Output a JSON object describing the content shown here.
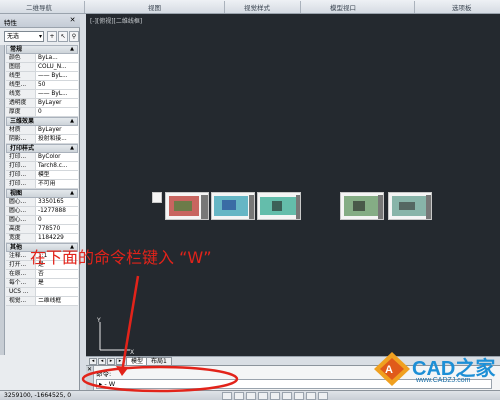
{
  "ribbon": {
    "panels": [
      "二维导航",
      "视图",
      "视觉样式",
      "模型视口",
      "选项板"
    ]
  },
  "palette": {
    "title": "特性",
    "selection": "无选",
    "sections": [
      {
        "title": "常规",
        "rows": [
          {
            "k": "颜色",
            "v": "ByLa..."
          },
          {
            "k": "图层",
            "v": "COLU_N..."
          },
          {
            "k": "线型",
            "v": "—— ByL..."
          },
          {
            "k": "线型...",
            "v": "50"
          },
          {
            "k": "线宽",
            "v": "—— ByL..."
          },
          {
            "k": "透明度",
            "v": "ByLayer"
          },
          {
            "k": "厚度",
            "v": "0"
          }
        ]
      },
      {
        "title": "三维效果",
        "rows": [
          {
            "k": "材质",
            "v": "ByLayer"
          },
          {
            "k": "阴影...",
            "v": "投射和接..."
          }
        ]
      },
      {
        "title": "打印样式",
        "rows": [
          {
            "k": "打印...",
            "v": "ByColor"
          },
          {
            "k": "打印...",
            "v": "Tarch8.c..."
          },
          {
            "k": "打印...",
            "v": "模型"
          },
          {
            "k": "打印...",
            "v": "不可用"
          }
        ]
      },
      {
        "title": "视图",
        "rows": [
          {
            "k": "圆心...",
            "v": "3350165"
          },
          {
            "k": "圆心...",
            "v": "-1277888"
          },
          {
            "k": "圆心...",
            "v": "0"
          },
          {
            "k": "高度",
            "v": "778570"
          },
          {
            "k": "宽度",
            "v": "1184229"
          }
        ]
      },
      {
        "title": "其他",
        "rows": [
          {
            "k": "注释...",
            "v": "1:1"
          },
          {
            "k": "打开...",
            "v": "是"
          },
          {
            "k": "在原...",
            "v": "否"
          },
          {
            "k": "每个...",
            "v": "是"
          },
          {
            "k": "UCS ...",
            "v": ""
          },
          {
            "k": "视觉...",
            "v": "二维线框"
          }
        ]
      }
    ]
  },
  "viewport": {
    "label": "[-][俯视][二维线框]"
  },
  "annotation": {
    "text": "在下面的命令栏键入 “W”",
    "color": "#e2231a"
  },
  "tabs": {
    "model": "模型",
    "layout": "布局1"
  },
  "command": {
    "history": "命令:",
    "input": "W"
  },
  "status": {
    "coords": "3259100, -1664525, 0"
  },
  "watermark": {
    "brand": "CAD之家",
    "url": "www.CADZJ.com"
  },
  "colors": {
    "viewport_bg": "#24292f",
    "accent_red": "#e2231a",
    "watermark_blue": "#1d8fd6"
  }
}
